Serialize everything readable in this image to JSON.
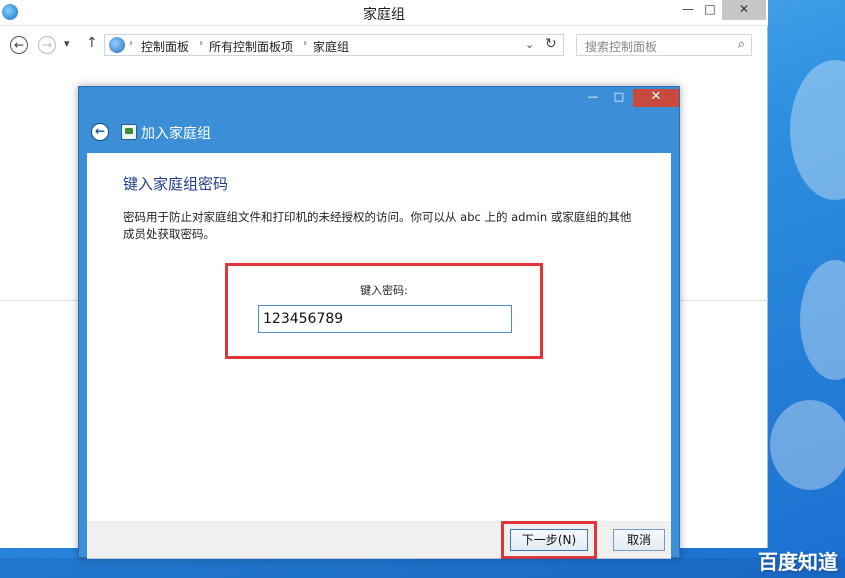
{
  "explorer": {
    "title": "家庭组",
    "window_controls": {
      "minimize": "—",
      "maximize": "□",
      "close": "✕"
    },
    "nav": {
      "back": "←",
      "forward": "→",
      "recent": "▾",
      "up": "↑"
    },
    "breadcrumbs": [
      "控制面板",
      "所有控制面板项",
      "家庭组"
    ],
    "crumb_separator": "›",
    "address_dropdown": "⌄",
    "refresh": "↻",
    "search_placeholder": "搜索控制面板",
    "search_icon": "⌕"
  },
  "dialog": {
    "window_controls": {
      "minimize": "—",
      "maximize": "□",
      "close": "✕"
    },
    "back": "←",
    "header_title": "加入家庭组",
    "heading": "键入家庭组密码",
    "description": "密码用于防止对家庭组文件和打印机的未经授权的访问。你可以从 abc 上的 admin 或家庭组的其他成员处获取密码。",
    "password_label": "键入密码:",
    "password_value": "123456789",
    "next_button": "下一步(N)",
    "cancel_button": "取消"
  },
  "watermark": "百度知道",
  "colors": {
    "dialog_frame": "#3c8fd6",
    "heading": "#1e3f8a",
    "highlight": "#e0363a"
  }
}
